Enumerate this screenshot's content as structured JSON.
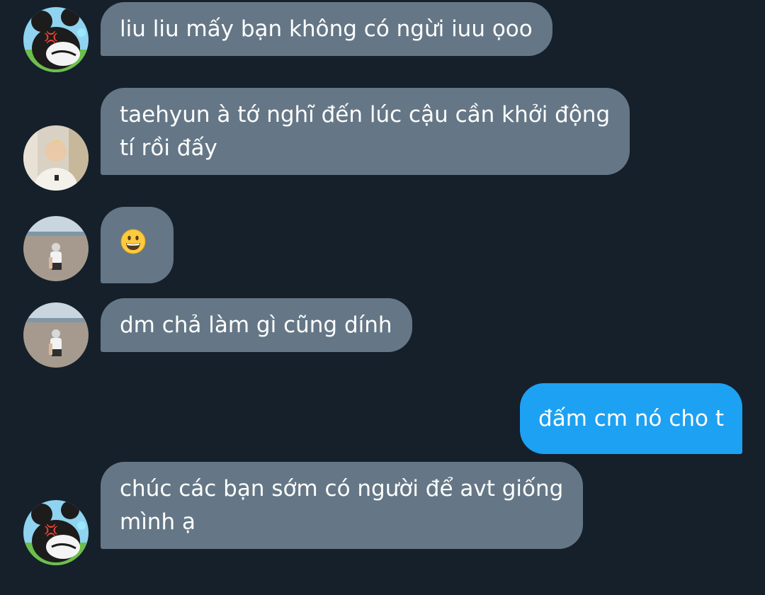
{
  "conversation": {
    "messages": [
      {
        "direction": "incoming",
        "avatar": "cartoon-mouse-avatar",
        "lines": [
          "liu liu mấy bạn không có ngừi iuu ọoo"
        ]
      },
      {
        "direction": "incoming",
        "avatar": "blond-person-avatar",
        "lines": [
          "taehyun à tớ nghĩ đến lúc cậu cần khởi động",
          "tí rồi đấy"
        ]
      },
      {
        "direction": "incoming",
        "avatar": "beach-photo-avatar",
        "emoji": "grinning-face-emoji"
      },
      {
        "direction": "incoming",
        "avatar": "beach-photo-avatar",
        "lines": [
          "dm chả làm gì cũng dính"
        ]
      },
      {
        "direction": "outgoing",
        "lines": [
          "đấm cm nó cho t"
        ]
      },
      {
        "direction": "incoming",
        "avatar": "cartoon-mouse-avatar",
        "lines": [
          "chúc các bạn sớm có người để avt giống",
          "mình ạ"
        ]
      }
    ]
  },
  "colors": {
    "background": "#15202b",
    "incoming_bubble": "#657786",
    "outgoing_bubble": "#1da1f2",
    "text": "#ffffff"
  }
}
